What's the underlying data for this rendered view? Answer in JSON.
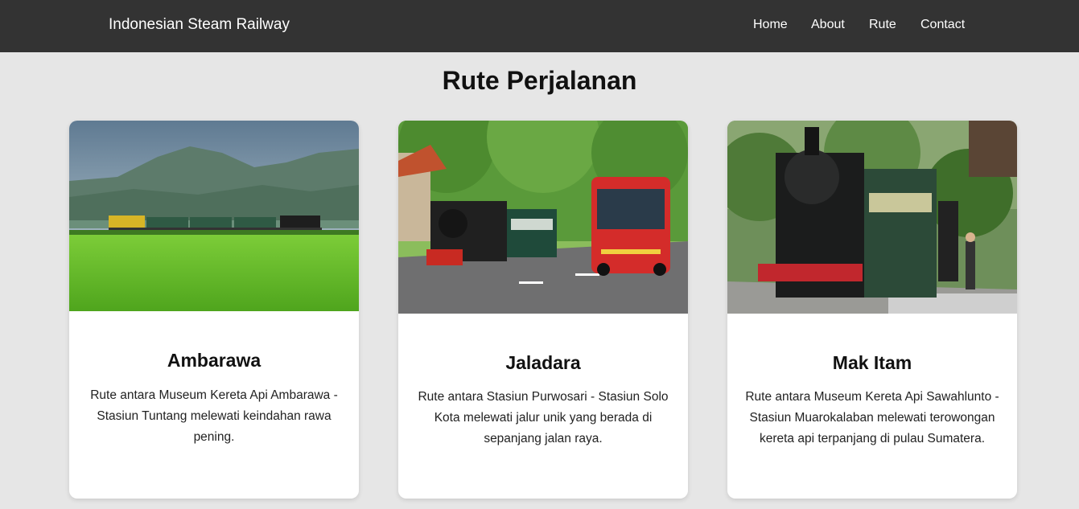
{
  "navbar": {
    "brand": "Indonesian Steam Railway",
    "links": [
      "Home",
      "About",
      "Rute",
      "Contact"
    ],
    "background": "#333333"
  },
  "page": {
    "title": "Rute Perjalanan",
    "background": "#e6e6e6"
  },
  "cards": [
    {
      "title": "Ambarawa",
      "description": "Rute antara Museum Kereta Api Ambarawa - Stasiun Tuntang melewati keindahan rawa pening.",
      "image": "steam-train-rice-field-photo"
    },
    {
      "title": "Jaladara",
      "description": "Rute antara Stasiun Purwosari - Stasiun Solo Kota melewati jalur unik yang berada di sepanjang jalan raya.",
      "image": "steam-train-street-bus-photo"
    },
    {
      "title": "Mak Itam",
      "description": "Rute antara Museum Kereta Api Sawahlunto - Stasiun Muarokalaban melewati terowongan kereta api terpanjang di pulau Sumatera.",
      "image": "black-steam-locomotive-station-photo"
    }
  ]
}
